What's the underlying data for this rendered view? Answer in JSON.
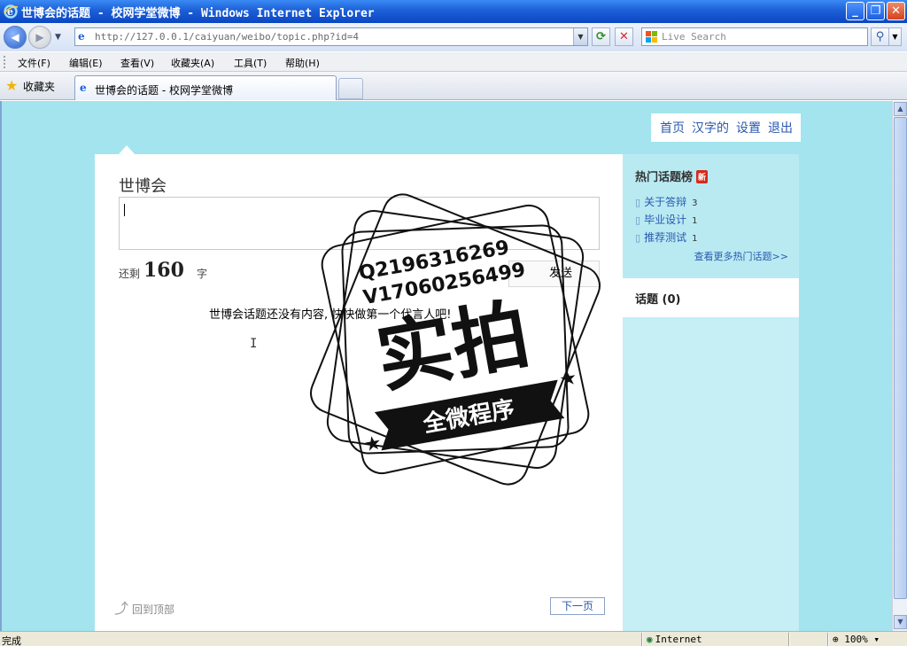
{
  "window": {
    "title": "世博会的话题 - 校网学堂微博 - Windows Internet Explorer"
  },
  "address_bar": {
    "url": "http://127.0.0.1/caiyuan/weibo/topic.php?id=4",
    "search_placeholder": "Live Search"
  },
  "menu": {
    "items": [
      "文件(F)",
      "编辑(E)",
      "查看(V)",
      "收藏夹(A)",
      "工具(T)",
      "帮助(H)"
    ]
  },
  "favorites": {
    "label": "收藏夹"
  },
  "tab": {
    "label": "世博会的话题 - 校网学堂微博"
  },
  "topnav": {
    "items": [
      "首页",
      "汉字的",
      "设置",
      "退出"
    ]
  },
  "main": {
    "topic_title": "世博会",
    "post_input_value": "",
    "remain_prefix": "还剩",
    "remain_count": "160",
    "remain_suffix": "字",
    "send_label": "发送",
    "empty_message": "世博会话题还没有内容, 快快做第一个代言人吧!",
    "back_to_top": "回到顶部",
    "next_page": "下一页"
  },
  "sidebar": {
    "hot_title": "热门话题榜",
    "new_badge": "新",
    "hot_items": [
      {
        "label": "关于答辩",
        "count": "3"
      },
      {
        "label": "毕业设计",
        "count": "1"
      },
      {
        "label": "推荐测试",
        "count": "1"
      }
    ],
    "more_link": "查看更多热门话题>>",
    "topics_label": "话题 (0)"
  },
  "watermark": {
    "line1": "Q2196316269",
    "line2": "V17060256499",
    "main": "实拍",
    "ribbon": "全微程序"
  },
  "status_bar": {
    "status": "完成",
    "zone": "Internet",
    "zoom": "100%"
  },
  "colors": {
    "page_bg": "#a4e4ee",
    "link": "#2a59b0",
    "sidebar_bg": "#c5eef5"
  }
}
